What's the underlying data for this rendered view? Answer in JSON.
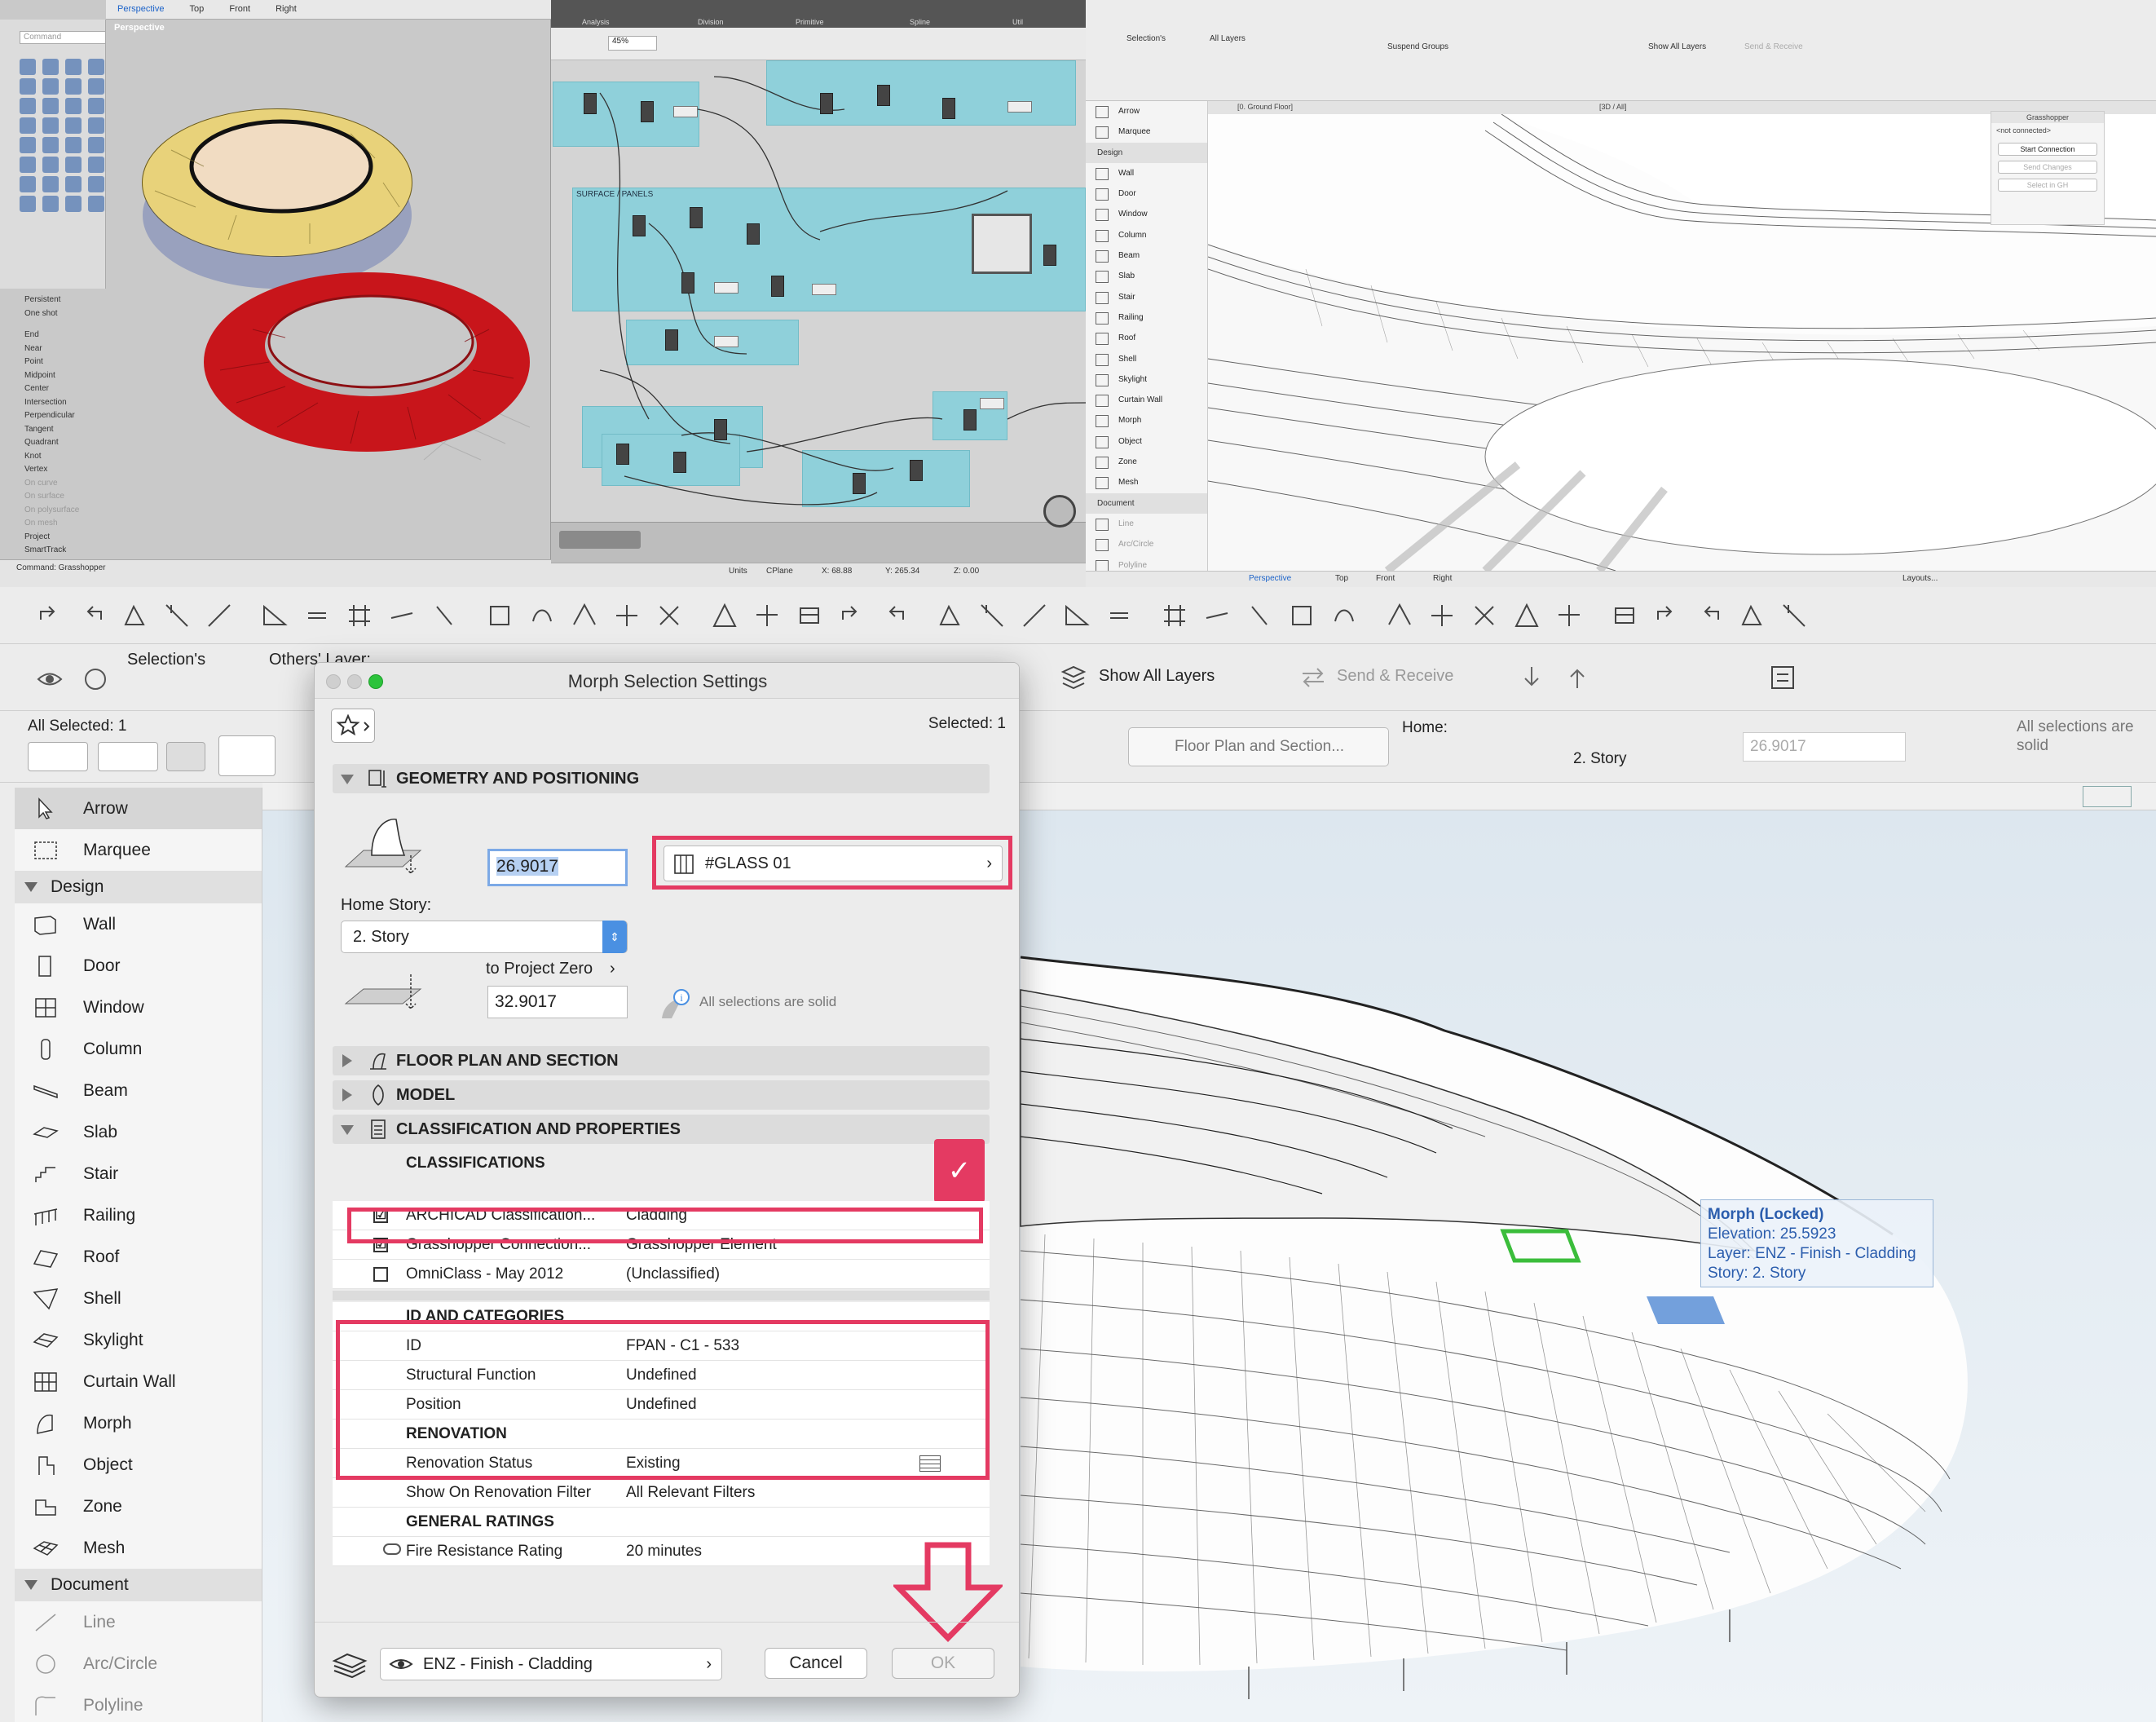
{
  "rhino": {
    "tabs": [
      "Perspective",
      "Top",
      "Front",
      "Right"
    ],
    "viewport_name": "Perspective",
    "command_placeholder": "Command",
    "osnap_top": [
      "Persistent",
      "One shot"
    ],
    "osnaps": [
      "End",
      "Near",
      "Point",
      "Midpoint",
      "Center",
      "Intersection",
      "Perpendicular",
      "Tangent",
      "Quadrant",
      "Knot",
      "Vertex",
      "On curve",
      "On surface",
      "On polysurface",
      "On mesh",
      "Project",
      "SmartTrack"
    ],
    "command_line": "Command: Grasshopper",
    "status": {
      "units": "Units",
      "cplane": "CPlane",
      "x": "X: 68.88",
      "y": "Y: 265.34",
      "z": "Z: 0.00"
    }
  },
  "grasshopper": {
    "ribbon_groups": [
      "Analysis",
      "Division",
      "Primitive",
      "Spline",
      "Util"
    ],
    "zoom": "45%",
    "group_label": "SURFACE / PANELS"
  },
  "archicad_small": {
    "toolbar_labels": [
      "Selection's",
      "All Layers",
      "Suspend Groups",
      "Show All Layers",
      "Send & Receive"
    ],
    "tabs": [
      "[0. Ground Floor]",
      "[3D / All]"
    ],
    "toolbox_items": [
      "Arrow",
      "Marquee"
    ],
    "toolbox_design_header": "Design",
    "toolbox_design": [
      "Wall",
      "Door",
      "Window",
      "Column",
      "Beam",
      "Slab",
      "Stair",
      "Railing",
      "Roof",
      "Shell",
      "Skylight",
      "Curtain Wall",
      "Morph",
      "Object",
      "Zone",
      "Mesh"
    ],
    "toolbox_document_header": "Document",
    "toolbox_document": [
      "Line",
      "Arc/Circle",
      "Polyline"
    ],
    "gh_palette": {
      "title": "Grasshopper",
      "status": "<not connected>",
      "start": "Start Connection",
      "send": "Send Changes",
      "select": "Select in GH"
    },
    "bottom_tabs": [
      "Perspective",
      "Top",
      "Front",
      "Right"
    ],
    "layouts": "Layouts..."
  },
  "toolbar": {
    "selections_label": "Selection's",
    "others_layer_label": "Others' Layer:",
    "show_all_layers": "Show All Layers",
    "send_receive": "Send & Receive",
    "all_selected": "All Selected: 1",
    "floor_plan_section": "Floor Plan and Section...",
    "home_label": "Home:",
    "story": "2. Story",
    "elevation": "26.9017",
    "solid_note": "All selections are solid"
  },
  "toolbox": {
    "items": [
      "Arrow",
      "Marquee"
    ],
    "design_header": "Design",
    "design": [
      "Wall",
      "Door",
      "Window",
      "Column",
      "Beam",
      "Slab",
      "Stair",
      "Railing",
      "Roof",
      "Shell",
      "Skylight",
      "Curtain Wall",
      "Morph",
      "Object",
      "Zone",
      "Mesh"
    ],
    "document_header": "Document",
    "document": [
      "Line",
      "Arc/Circle",
      "Polyline"
    ]
  },
  "tooltip": {
    "title": "Morph (Locked)",
    "elevation": "Elevation: 25.5923",
    "layer": "Layer: ENZ - Finish - Cladding",
    "story": "Story: 2. Story"
  },
  "dialog": {
    "title": "Morph Selection Settings",
    "selected": "Selected: 1",
    "geometry_header": "GEOMETRY AND POSITIONING",
    "elevation_value": "26.9017",
    "surface": "#GLASS 01",
    "home_story_label": "Home Story:",
    "home_story": "2. Story",
    "to_project_zero": "to Project Zero",
    "project_zero_value": "32.9017",
    "solid_note": "All selections are solid",
    "floor_plan_header": "FLOOR PLAN AND SECTION",
    "model_header": "MODEL",
    "classification_header": "CLASSIFICATION AND PROPERTIES",
    "classifications_title": "CLASSIFICATIONS",
    "classifications": [
      {
        "name": "ARCHICAD Classification...",
        "value": "Cladding",
        "checked": "☑"
      },
      {
        "name": "Grasshopper Connection...",
        "value": "Grasshopper Element",
        "checked": "☑"
      },
      {
        "name": "OmniClass - May 2012",
        "value": "(Unclassified)",
        "checked": ""
      }
    ],
    "id_header": "ID AND CATEGORIES",
    "id_rows": [
      {
        "name": "ID",
        "value": "FPAN - C1 - 533"
      },
      {
        "name": "Structural Function",
        "value": "Undefined"
      },
      {
        "name": "Position",
        "value": "Undefined"
      }
    ],
    "renovation_header": "RENOVATION",
    "renovation_rows": [
      {
        "name": "Renovation Status",
        "value": "Existing"
      },
      {
        "name": "Show On Renovation Filter",
        "value": "All Relevant Filters"
      }
    ],
    "general_header": "GENERAL RATINGS",
    "general_rows": [
      {
        "name": "Fire Resistance Rating",
        "value": "20 minutes"
      }
    ],
    "layer": "ENZ - Finish - Cladding",
    "cancel": "Cancel",
    "ok": "OK"
  },
  "colors": {
    "accent_red": "#e43a62",
    "gh_group": "#8fd0da",
    "rhino_red": "#c8151b",
    "highlight_blue": "#b6d0f2"
  }
}
